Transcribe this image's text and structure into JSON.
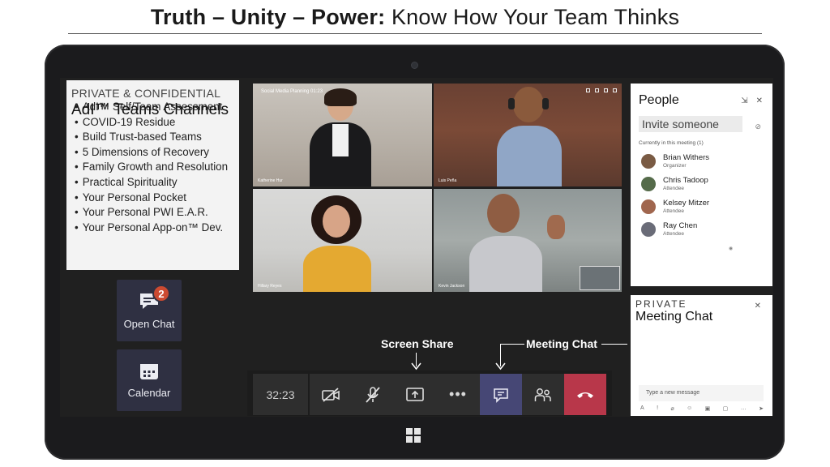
{
  "title": {
    "bold_part": "Truth – Unity – Power:",
    "light_part": " Know How Your Team Thinks"
  },
  "info_card": {
    "caption": "PRIVATE & CONFIDENTIAL",
    "heading": "AdI™ Teams Channels",
    "items": [
      "AdI™ Self/Team Assessment",
      "COVID-19 Residue",
      "Build Trust-based Teams",
      "5 Dimensions of Recovery",
      "Family Growth and Resolution",
      "Practical Spirituality",
      "Your Personal Pocket",
      "Your Personal PWI E.A.R.",
      "Your Personal App-on™ Dev."
    ]
  },
  "tiles": {
    "open_chat": {
      "label": "Open Chat",
      "badge": "2",
      "icon": "chat-bubble-icon"
    },
    "calendar": {
      "label": "Calendar",
      "icon": "calendar-icon"
    }
  },
  "video": {
    "meeting_name": "Social Media Planning",
    "meeting_time": "01:23",
    "tiles": [
      {
        "name": "Katherine Hur"
      },
      {
        "name": "Luis Peña"
      },
      {
        "name": "Hillary Reyes"
      },
      {
        "name": "Kevin Jackson"
      }
    ]
  },
  "people_panel": {
    "title": "People",
    "invite_placeholder": "Invite someone",
    "in_meeting_label": "Currently in this meeting (1)",
    "participants": [
      {
        "name": "Brian Withers",
        "role": "Organizer",
        "avatar_color": "#7a5b44"
      },
      {
        "name": "Chris Tadoop",
        "role": "Attendee",
        "avatar_color": "#556b4a"
      },
      {
        "name": "Kelsey Mitzer",
        "role": "Attendee",
        "avatar_color": "#a0664e"
      },
      {
        "name": "Ray Chen",
        "role": "Attendee",
        "avatar_color": "#6a6c78"
      }
    ]
  },
  "chat_panel": {
    "caption": "PRIVATE",
    "title": "Meeting Chat",
    "message_placeholder": "Type a new message"
  },
  "toolbar": {
    "timer": "32:23",
    "more_label": "•••"
  },
  "callouts": {
    "screen_share": "Screen Share",
    "meeting_chat": "Meeting Chat"
  },
  "colors": {
    "tile_bg": "#2f3042",
    "badge": "#cc4a31",
    "chat_active": "#464775",
    "hang_up": "#b8374a"
  }
}
